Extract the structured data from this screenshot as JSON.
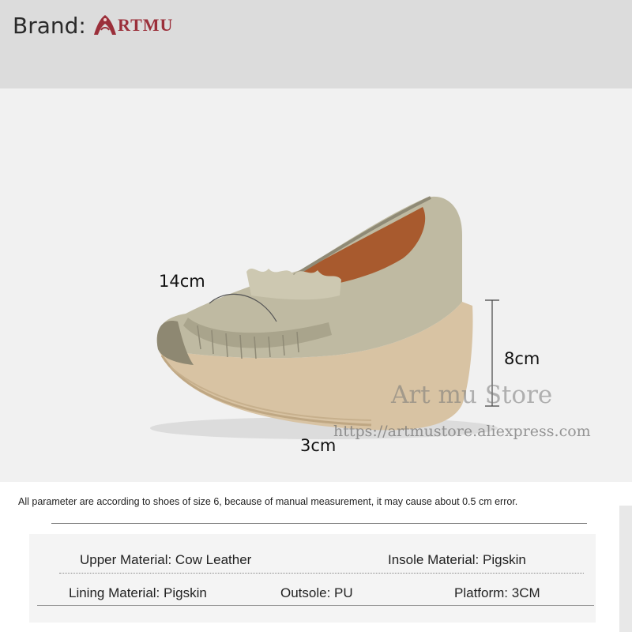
{
  "header": {
    "brand_label": "Brand:",
    "brand_logo_text": "RTMU",
    "brand_color": "#9b2f3a"
  },
  "product_image": {
    "icon": "shoe-image",
    "dimensions": {
      "length": "14cm",
      "heel_height": "8cm",
      "platform": "3cm"
    },
    "watermark": "Art mu Store",
    "watermark_url": "https://artmustore.aliexpress.com"
  },
  "info": {
    "note": "All parameter are according to shoes of size 6, because of manual measurement, it may cause about 0.5 cm error.",
    "specs": {
      "upper_material": "Upper Material: Cow Leather",
      "insole_material": "Insole Material: Pigskin",
      "lining_material": "Lining Material: Pigskin",
      "outsole": "Outsole: PU",
      "platform": "Platform: 3CM"
    }
  }
}
